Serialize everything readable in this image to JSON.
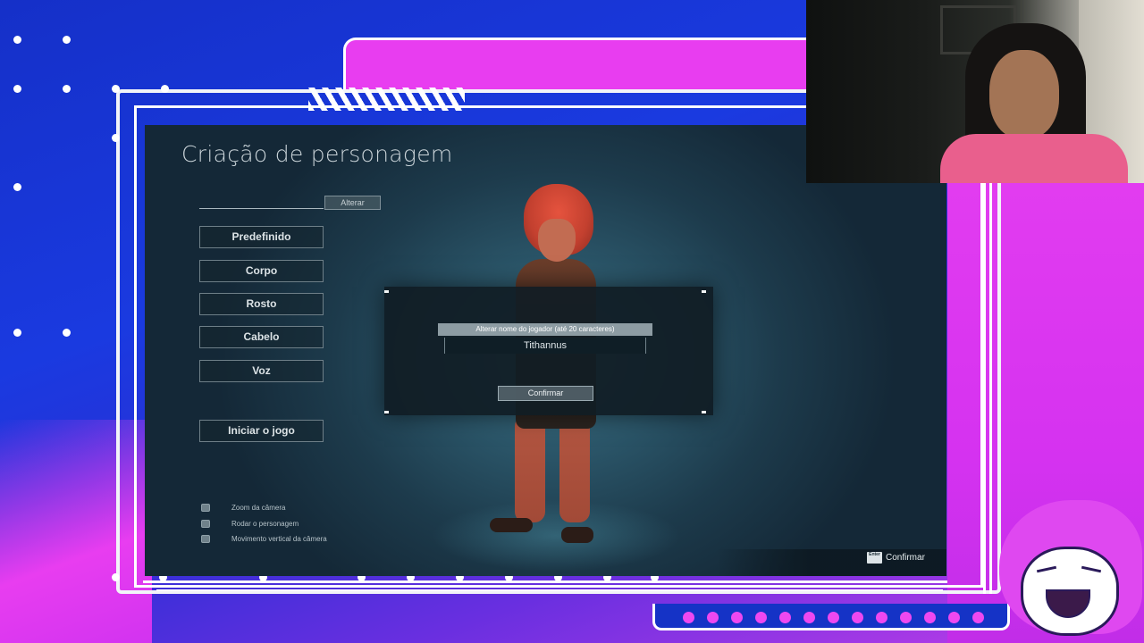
{
  "game": {
    "title": "Criação de personagem",
    "alter_button": "Alterar",
    "menu": [
      {
        "label": "Predefinido"
      },
      {
        "label": "Corpo"
      },
      {
        "label": "Rosto"
      },
      {
        "label": "Cabelo"
      },
      {
        "label": "Voz"
      }
    ],
    "start_button": "Iniciar o jogo",
    "hints": [
      {
        "icon": "mouse-wheel-icon",
        "label": "Zoom da câmera"
      },
      {
        "icon": "mouse-drag-icon",
        "label": "Rodar o personagem"
      },
      {
        "icon": "mouse-move-icon",
        "label": "Movimento vertical da câmera"
      }
    ],
    "bottom_bar": {
      "key_label": "Enter",
      "action_label": "Confirmar"
    },
    "dialog": {
      "label": "Alterar nome do jogador (até 20 caracteres)",
      "input_value": "Tithannus",
      "confirm_label": "Confirmar"
    }
  },
  "colors": {
    "overlay_blue": "#1a3ae0",
    "overlay_pink": "#e83df0",
    "game_bg": "#2a5467"
  }
}
